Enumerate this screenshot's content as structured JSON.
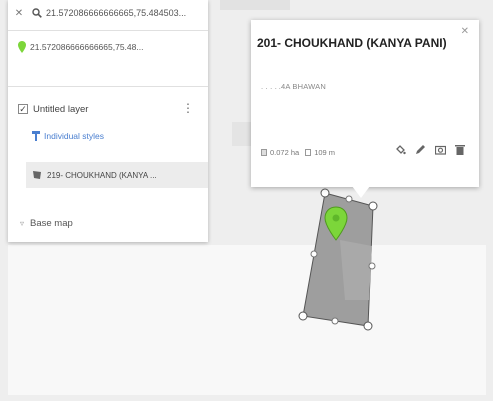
{
  "search": {
    "query": "21.572086666666665,75.484503..."
  },
  "result": {
    "label": "21.572086666666665,75.48..."
  },
  "layer": {
    "name": "Untitled layer",
    "styles_label": "Individual styles",
    "feature_label": "219- CHOUKHAND (KANYA ..."
  },
  "basemap": {
    "label": "Base map"
  },
  "popup": {
    "title": "201- CHOUKHAND (KANYA PANI)",
    "description": ". . . . .4A BHAWAN",
    "area": "0.072 ha",
    "perimeter": "109 m"
  },
  "colors": {
    "pin": "#7cd63a",
    "polygon_fill": "#9e9e9e",
    "link": "#4a7fd0"
  },
  "icons": [
    "close-icon",
    "search-icon",
    "map-pin-icon",
    "checkbox-icon",
    "more-vert-icon",
    "paint-brush-icon",
    "polygon-icon",
    "expand-icon",
    "paint-bucket-icon",
    "pencil-icon",
    "camera-icon",
    "trash-icon",
    "area-icon",
    "perimeter-icon"
  ]
}
